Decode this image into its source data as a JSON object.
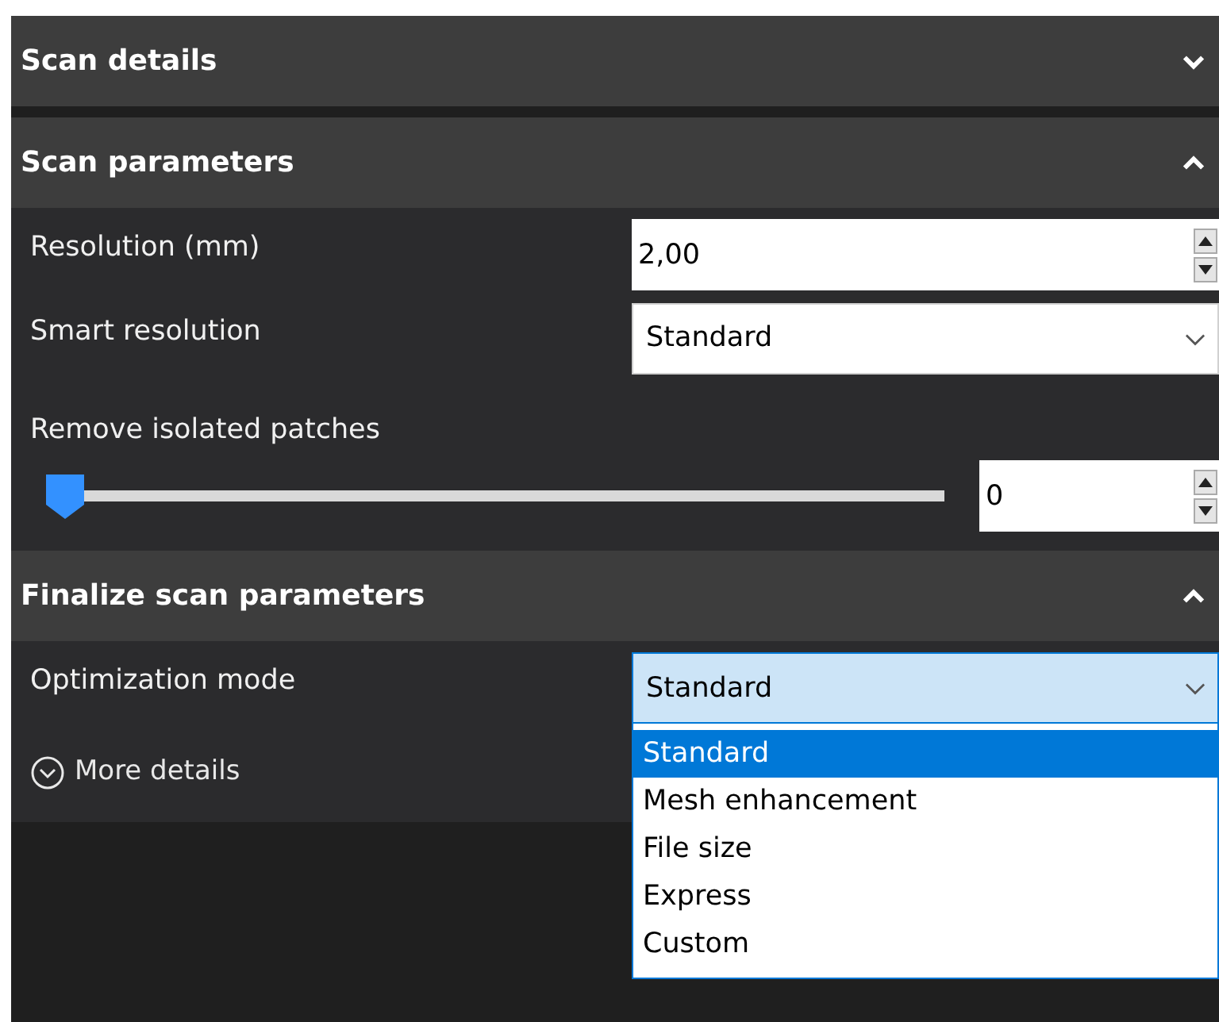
{
  "sections": [
    {
      "title": "Scan details",
      "expanded": false
    },
    {
      "title": "Scan parameters",
      "expanded": true,
      "fields": [
        {
          "kind": "spin",
          "label": "Resolution (mm)",
          "value": "2,00"
        },
        {
          "kind": "select",
          "label": "Smart resolution",
          "value": "Standard",
          "open": false
        },
        {
          "kind": "slider",
          "label": "Remove isolated patches",
          "level": 0,
          "value": "0"
        }
      ]
    },
    {
      "title": "Finalize scan parameters",
      "expanded": true,
      "fields": [
        {
          "kind": "select",
          "label": "Optimization mode",
          "value": "Standard",
          "open": true,
          "options": [
            {
              "label": "Standard",
              "selected": true
            },
            {
              "label": "Mesh enhancement",
              "selected": false
            },
            {
              "label": "File size",
              "selected": false
            },
            {
              "label": "Express",
              "selected": false
            },
            {
              "label": "Custom",
              "selected": false
            }
          ]
        },
        {
          "kind": "link",
          "label": "More details"
        }
      ]
    }
  ]
}
